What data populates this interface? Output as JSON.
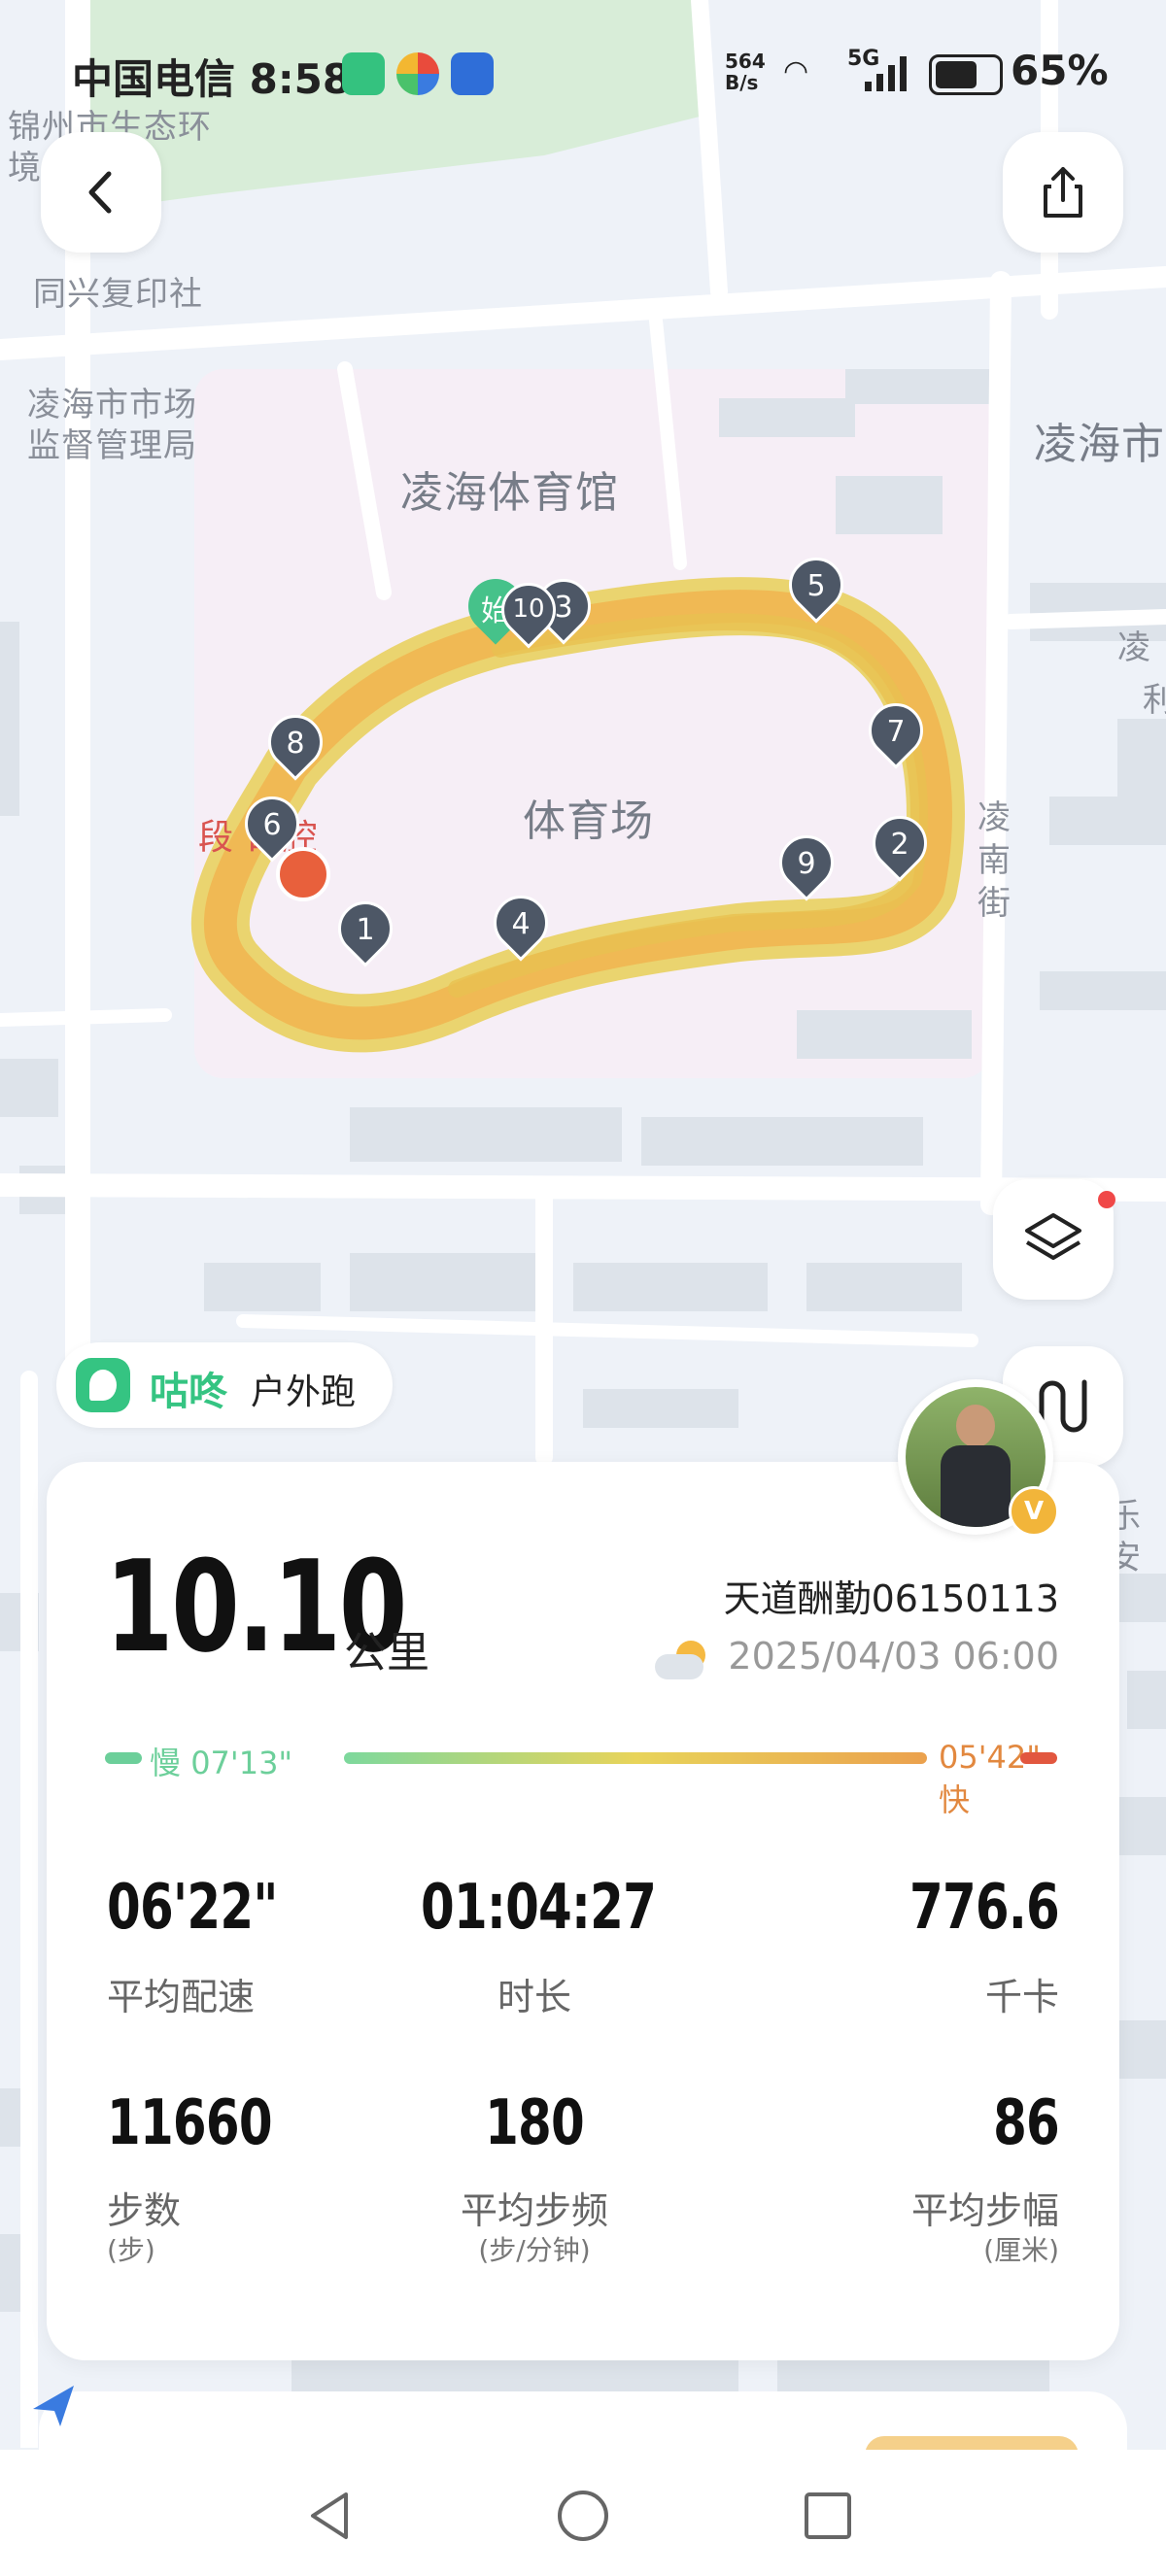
{
  "status_bar": {
    "carrier": "中国电信",
    "time": "8:58",
    "net_speed_top": "564",
    "net_speed_bottom": "B/s",
    "network": "5G",
    "battery": "65%"
  },
  "map": {
    "labels": {
      "l1a": "锦州市生态环",
      "l1b": "境      分局",
      "l2": "同兴复印社",
      "l3a": "凌海市市场",
      "l3b": "监督管理局",
      "l4": "凌海体育馆",
      "l5": "凌海市",
      "l6": "体育场",
      "l7": "段  口腔",
      "l8": "凌南街",
      "l9": "凌",
      "l10": "利",
      "l11": "乐安"
    },
    "markers": [
      "1",
      "2",
      "3",
      "4",
      "5",
      "6",
      "7",
      "8",
      "9",
      "10"
    ],
    "start_marker": "始",
    "route_color": "#f0c24b"
  },
  "top": {
    "back_icon": "chevron-left-icon",
    "share_icon": "share-icon"
  },
  "side": {
    "layers_icon": "layers-icon",
    "route_icon": "route-icon"
  },
  "activity": {
    "app_name": "咕咚",
    "type": "户外跑"
  },
  "summary": {
    "distance": "10.10",
    "distance_unit": "公里",
    "user": "天道酬勤06150113",
    "datetime": "2025/04/03 06:00",
    "slow_label": "慢",
    "slow_pace": "07'13\"",
    "fast_label": "快",
    "fast_pace": "05'42\""
  },
  "stats": [
    {
      "value": "06'22\"",
      "label": "平均配速",
      "unit": ""
    },
    {
      "value": "01:04:27",
      "label": "时长",
      "unit": ""
    },
    {
      "value": "776.6",
      "label": "千卡",
      "unit": ""
    },
    {
      "value": "11660",
      "label": "步数",
      "unit": "(步)"
    },
    {
      "value": "180",
      "label": "平均步频",
      "unit": "(步/分钟)"
    },
    {
      "value": "86",
      "label": "平均步幅",
      "unit": "(厘米)"
    }
  ],
  "colors": {
    "accent_green": "#35c482",
    "fast_red": "#e2573f",
    "avatar_badge": "#f2b53a"
  }
}
